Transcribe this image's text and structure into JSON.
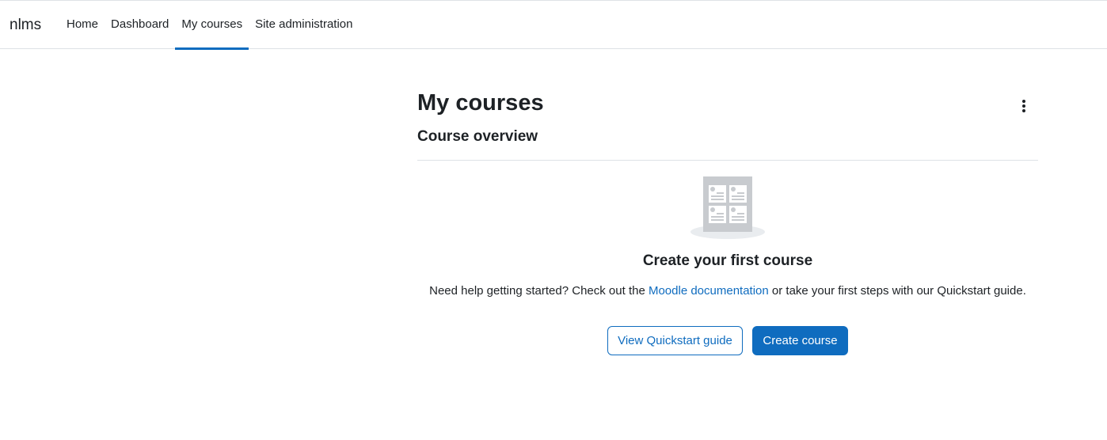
{
  "header": {
    "brand": "nlms",
    "nav": [
      {
        "label": "Home",
        "active": false
      },
      {
        "label": "Dashboard",
        "active": false
      },
      {
        "label": "My courses",
        "active": true
      },
      {
        "label": "Site administration",
        "active": false
      }
    ]
  },
  "main": {
    "page_title": "My courses",
    "actions_menu_icon": "kebab-vertical-icon",
    "section_title": "Course overview",
    "empty_state": {
      "illustration_icon": "courses-grid-illustration",
      "title": "Create your first course",
      "help_prefix": "Need help getting started? Check out the ",
      "help_link": "Moodle documentation",
      "help_suffix": " or take your first steps with our Quickstart guide.",
      "quickstart_button": "View Quickstart guide",
      "create_button": "Create course"
    }
  },
  "colors": {
    "accent": "#0f6cbf",
    "text": "#1d2125",
    "border": "#dee2e6",
    "illustration": "#c8cbcf"
  }
}
